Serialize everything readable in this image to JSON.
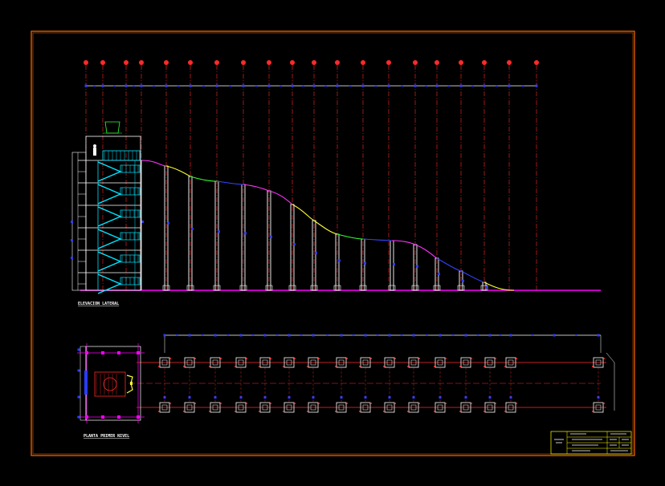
{
  "drawing": {
    "elevation_title": "ELEVACION LATERAL",
    "plan_title": "PLANTA PRIMER NIVEL",
    "axis_count": 18,
    "plan_column_count": 17
  },
  "colors": {
    "background": "#000000",
    "frame": "#ff6a00",
    "axis": "#ff2a2a",
    "dimension": "#ffffff",
    "dimension_tick": "#2a3cff",
    "stair": "#00e5ff",
    "ground": "#ff00ff",
    "curve_yellow": "#ffff33",
    "curve_green": "#33ff33",
    "curve_magenta": "#ff33ff",
    "curve_blue": "#3344ff",
    "titleblock": "#ffff00"
  },
  "titleblock": {
    "rows": [
      "",
      "",
      "",
      ""
    ]
  }
}
